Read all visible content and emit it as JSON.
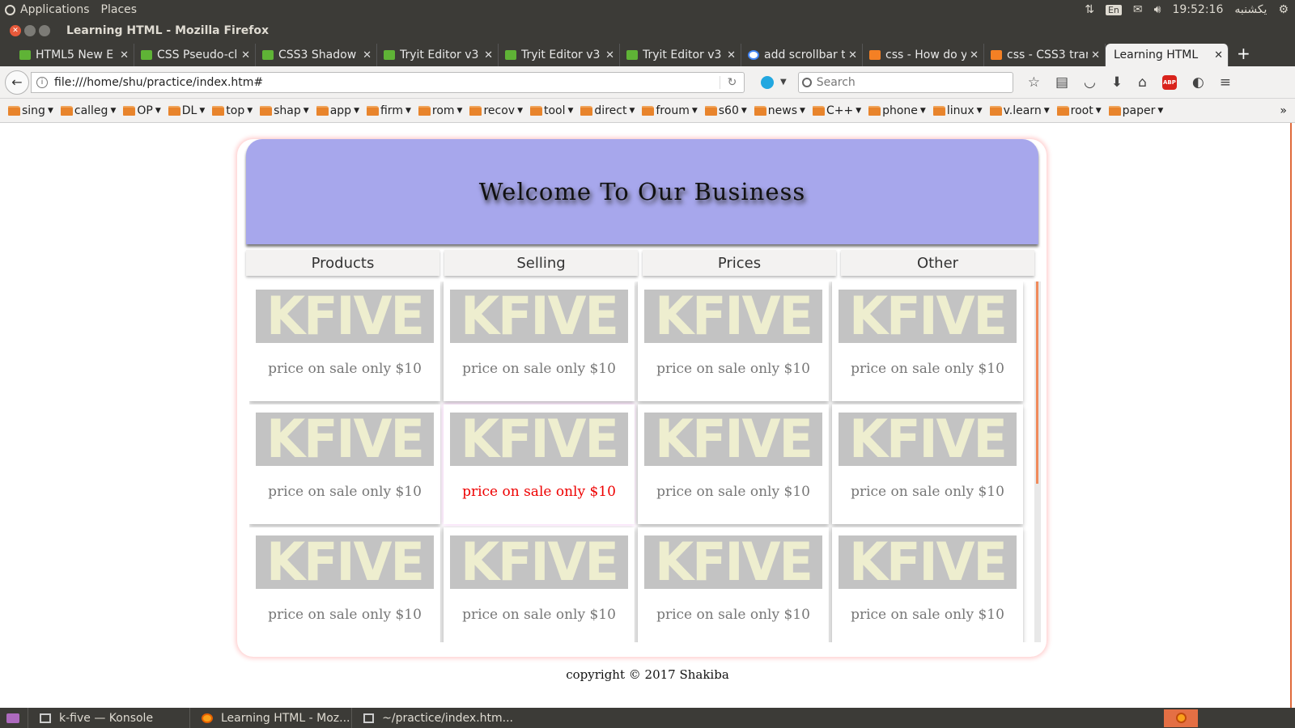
{
  "top_panel": {
    "applications": "Applications",
    "places": "Places",
    "lang": "En",
    "time": "19:52:16",
    "day": "یکشنبه"
  },
  "window": {
    "title": "Learning HTML - Mozilla Firefox"
  },
  "tabs": [
    {
      "label": "HTML5 New E",
      "icon": "w3-icon"
    },
    {
      "label": "CSS Pseudo-cl",
      "icon": "w3-icon"
    },
    {
      "label": "CSS3 Shadow",
      "icon": "w3-icon"
    },
    {
      "label": "Tryit Editor v3",
      "icon": "w3-icon"
    },
    {
      "label": "Tryit Editor v3",
      "icon": "w3-icon"
    },
    {
      "label": "Tryit Editor v3",
      "icon": "w3-icon"
    },
    {
      "label": "add scrollbar t",
      "icon": "google-icon"
    },
    {
      "label": "css - How do y",
      "icon": "stackoverflow-icon"
    },
    {
      "label": "css - CSS3 tran",
      "icon": "stackoverflow-icon"
    },
    {
      "label": "Learning HTML",
      "icon": "",
      "active": true
    }
  ],
  "navbar": {
    "url": "file:///home/shu/practice/index.htm#",
    "search_placeholder": "Search"
  },
  "bookmarks": [
    "sing",
    "calleg",
    "OP",
    "DL",
    "top",
    "shap",
    "app",
    "firm",
    "rom",
    "recov",
    "tool",
    "direct",
    "froum",
    "s60",
    "news",
    "C++",
    "phone",
    "linux",
    "v.learn",
    "root",
    "paper"
  ],
  "page": {
    "heading": "Welcome To Our Business",
    "menu": [
      "Products",
      "Selling",
      "Prices",
      "Other"
    ],
    "banner_text": "KFIVE",
    "price_text": "price on sale only $10",
    "copyright": "copyright © 2017 Shakiba"
  },
  "taskbar": {
    "items": [
      "k-five — Konsole",
      "Learning HTML - Moz...",
      "~/practice/index.htm..."
    ]
  },
  "colors": {
    "header_bg": "#a7a7ec",
    "highlight_price": "#ee0000",
    "panel_bg": "#3c3b37"
  }
}
